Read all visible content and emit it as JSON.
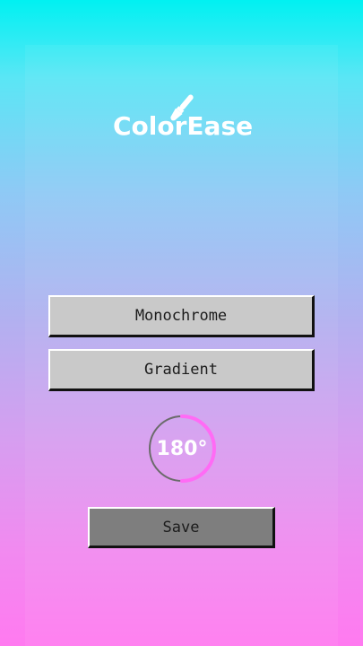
{
  "app": {
    "name": "ColorEase"
  },
  "icons": {
    "logo_icon": "paintbrush-icon"
  },
  "colors": {
    "gradient_top": "#00f1f2",
    "gradient_bottom": "#ff7af0",
    "button_face": "#c9c9c9",
    "save_button_face": "#7e7e7e",
    "dial_accent": "#ff6bf5"
  },
  "modes": {
    "monochrome_label": "Monochrome",
    "gradient_label": "Gradient"
  },
  "angle": {
    "display": "180°",
    "value_degrees": 180,
    "fill_fraction": 0.5
  },
  "actions": {
    "save_label": "Save"
  }
}
